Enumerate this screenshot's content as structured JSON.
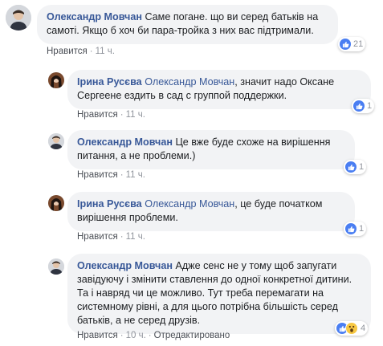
{
  "colors": {
    "link": "#385898",
    "bubble": "#f2f3f5",
    "like": "#4a7ef2",
    "wow": "#f7c843"
  },
  "comments": [
    {
      "author": "Олександр Мовчан",
      "text": "Саме погане. що ви серед батьків на самоті. Якщо б хоч би пара-тройка з них вас підтримали.",
      "like_label": "Нравится",
      "time": "11 ч.",
      "reactions": {
        "icons": [
          "like-icon"
        ],
        "count": "21"
      }
    },
    {
      "author": "Ірина Русєва",
      "mention": "Олександр Мовчан",
      "text": ", значит надо Оксане Сергеене ездить в сад с группой поддержки.",
      "like_label": "Нравится",
      "time": "11 ч.",
      "reactions": {
        "icons": [
          "like-icon"
        ],
        "count": "1"
      }
    },
    {
      "author": "Олександр Мовчан",
      "text": "Це вже буде схоже на вирішення питання, а не проблеми.)",
      "like_label": "Нравится",
      "time": "11 ч.",
      "reactions": {
        "icons": [
          "like-icon"
        ],
        "count": "1"
      }
    },
    {
      "author": "Ірина Русєва",
      "mention": "Олександр Мовчан",
      "text": ", це буде початком вирішення проблеми.",
      "like_label": "Нравится",
      "time": "11 ч.",
      "reactions": {
        "icons": [
          "like-icon"
        ],
        "count": "1"
      }
    },
    {
      "author": "Олександр Мовчан",
      "text": "Адже сенс не у тому щоб запугати завідуючу і змінити ставлення до одної конкретної дитини. Та і навряд чи це можливо. Тут треба перемагати на системному рівні, а для цього потрібна більшість серед батьків, а не серед друзів.",
      "like_label": "Нравится",
      "time": "10 ч.",
      "edited": "Отредактировано",
      "reactions": {
        "icons": [
          "like-icon",
          "wow-icon"
        ],
        "count": "4"
      }
    }
  ]
}
